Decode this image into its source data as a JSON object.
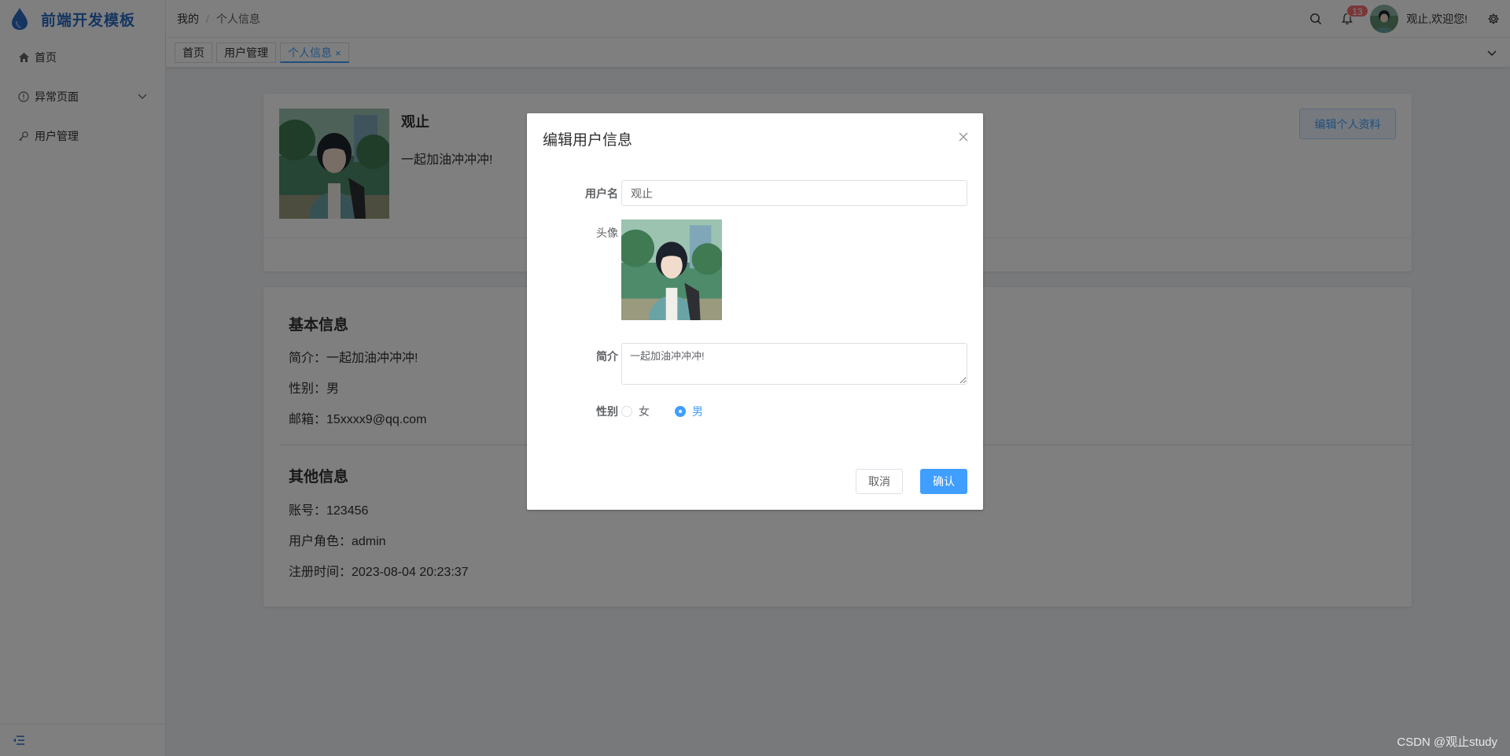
{
  "app": {
    "title": "前端开发模板"
  },
  "sidebar": {
    "items": [
      {
        "label": "首页",
        "icon": "home-icon"
      },
      {
        "label": "异常页面",
        "icon": "info-circle-icon",
        "expandable": true
      },
      {
        "label": "用户管理",
        "icon": "key-icon"
      }
    ]
  },
  "header": {
    "breadcrumb": [
      "我的",
      "个人信息"
    ],
    "notification_count": "13",
    "welcome": "观止,欢迎您!"
  },
  "tabs": [
    {
      "label": "首页",
      "active": false
    },
    {
      "label": "用户管理",
      "active": false
    },
    {
      "label": "个人信息",
      "active": true,
      "close": "×"
    }
  ],
  "profile": {
    "name": "观止",
    "bio": "一起加油冲冲冲!",
    "edit_button": "编辑个人资料"
  },
  "basic_info": {
    "title": "基本信息",
    "lines": [
      "简介：一起加油冲冲冲!",
      "性别：男",
      "邮箱：15xxxx9@qq.com"
    ]
  },
  "other_info": {
    "title": "其他信息",
    "lines": [
      "账号：123456",
      "用户角色：admin",
      "注册时间：2023-08-04 20:23:37"
    ]
  },
  "dialog": {
    "title": "编辑用户信息",
    "username_label": "用户名",
    "username_value": "观止",
    "avatar_label": "头像",
    "bio_label": "简介",
    "bio_value": "一起加油冲冲冲!",
    "gender_label": "性别",
    "gender_options": [
      "女",
      "男"
    ],
    "gender_selected": "男",
    "cancel": "取消",
    "confirm": "确认"
  },
  "watermark": "CSDN @观止study",
  "colors": {
    "primary": "#409eff",
    "brand": "#2d6dc2",
    "badge": "#f56c6c"
  }
}
